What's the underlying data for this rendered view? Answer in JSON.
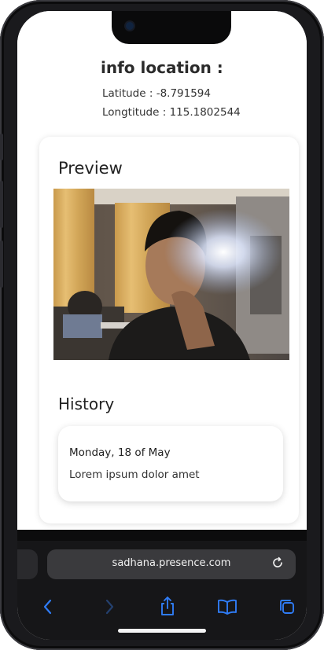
{
  "info": {
    "title": "info location :",
    "latitude_line": "Latitude : -8.791594",
    "longitude_line": "Longtitude : 115.1802544"
  },
  "preview": {
    "title": "Preview",
    "image_description_icon": "camera-photo"
  },
  "history": {
    "title": "History",
    "items": [
      {
        "date": "Monday, 18 of May",
        "description": "Lorem ipsum dolor amet"
      }
    ]
  },
  "browser": {
    "url": "sadhana.presence.com",
    "icons": [
      "back-icon",
      "forward-icon",
      "share-icon",
      "bookmarks-icon",
      "tabs-icon",
      "reload-icon"
    ]
  },
  "colors": {
    "accent": "#2f7cf6",
    "bezel": "#1a1a1d",
    "browser_bg": "#161618",
    "url_pill": "#3a3a3d"
  }
}
